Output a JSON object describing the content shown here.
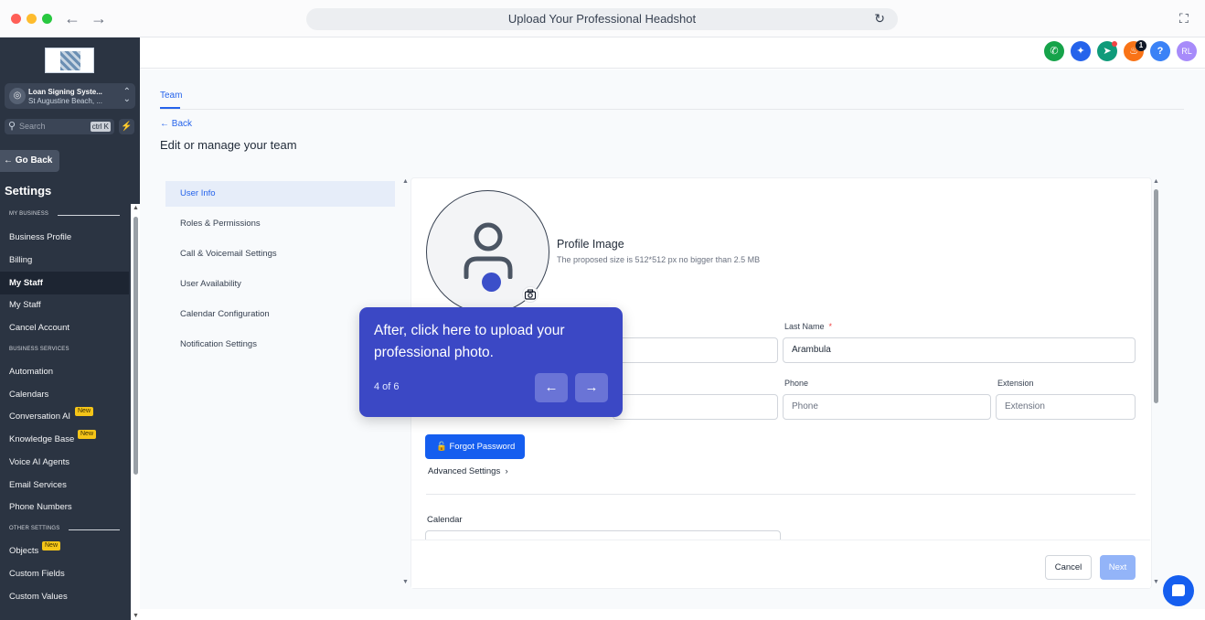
{
  "browser": {
    "title": "Upload Your Professional Headshot"
  },
  "colors": {
    "accent": "#155eef",
    "sidebar_bg": "#2b3442",
    "tooltip_bg": "#3b48c5",
    "new_badge": "#f5c518"
  },
  "sidebar": {
    "account_name": "Loan Signing Syste...",
    "account_location": "St Augustine Beach, ...",
    "search_placeholder": "Search",
    "search_shortcut": "ctrl K",
    "go_back": "Go Back",
    "settings_title": "Settings",
    "sections": {
      "my_business": "MY BUSINESS",
      "business_services": "BUSINESS SERVICES",
      "other_settings": "OTHER SETTINGS"
    },
    "items": {
      "business_profile": "Business Profile",
      "billing": "Billing",
      "my_staff_active": "My Staff",
      "my_staff": "My Staff",
      "cancel_account": "Cancel Account",
      "automation": "Automation",
      "calendars": "Calendars",
      "conversation_ai": "Conversation AI",
      "knowledge_base": "Knowledge Base",
      "voice_ai_agents": "Voice AI Agents",
      "email_services": "Email Services",
      "phone_numbers": "Phone Numbers",
      "objects": "Objects",
      "custom_fields": "Custom Fields",
      "custom_values": "Custom Values"
    },
    "new_badge": "New"
  },
  "header": {
    "notification_count": "1",
    "help": "?",
    "avatar_initials": "RL"
  },
  "main": {
    "tab": "Team",
    "back": "Back",
    "title": "Edit or manage your team",
    "left_nav": {
      "user_info": "User Info",
      "roles": "Roles & Permissions",
      "call_voicemail": "Call & Voicemail Settings",
      "availability": "User Availability",
      "calendar_config": "Calendar Configuration",
      "notifications": "Notification Settings"
    },
    "profile_image": {
      "title": "Profile Image",
      "subtitle": "The proposed size is 512*512 px no bigger than 2.5 MB"
    },
    "fields": {
      "last_name_label": "Last Name",
      "required_mark": "*",
      "last_name_value": "Arambula",
      "phone_label": "Phone",
      "phone_placeholder": "Phone",
      "extension_label": "Extension",
      "extension_placeholder": "Extension"
    },
    "forgot_password": "Forgot Password",
    "advanced_settings": "Advanced Settings",
    "calendar_label": "Calendar",
    "cancel": "Cancel",
    "next": "Next"
  },
  "tooltip": {
    "message": "After, click here to upload your professional photo.",
    "step": "4 of 6"
  }
}
